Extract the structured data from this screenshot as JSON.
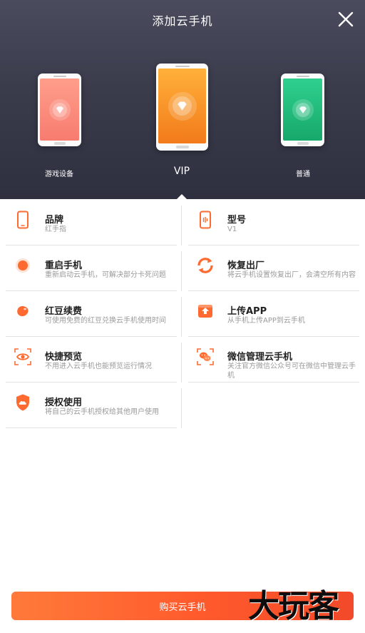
{
  "header": {
    "title": "添加云手机"
  },
  "phones": [
    {
      "label": "游戏设备",
      "color": "#f77c70"
    },
    {
      "label": "VIP",
      "color": "#f27a1a"
    },
    {
      "label": "普通",
      "color": "#17a86b"
    }
  ],
  "features": {
    "left": [
      {
        "title": "品牌",
        "desc": "红手指",
        "icon": "phone-outline-icon"
      },
      {
        "title": "重启手机",
        "desc": "重新启动云手机，可解决部分卡死问题",
        "icon": "restart-icon"
      },
      {
        "title": "红豆续费",
        "desc": "可使用免费的红豆兑换云手机使用时间",
        "icon": "bean-icon"
      },
      {
        "title": "快捷预览",
        "desc": "不用进入云手机也能预览运行情况",
        "icon": "eye-icon"
      },
      {
        "title": "授权使用",
        "desc": "将自己的云手机授权给其他用户使用",
        "icon": "shield-cloud-icon"
      }
    ],
    "right": [
      {
        "title": "型号",
        "desc": "V1",
        "icon": "phone-model-icon"
      },
      {
        "title": "恢复出厂",
        "desc": "将云手机设置恢复出厂，会清空所有内容",
        "icon": "factory-reset-icon"
      },
      {
        "title": "上传APP",
        "desc": "从手机上传APP到云手机",
        "icon": "upload-icon"
      },
      {
        "title": "微信管理云手机",
        "desc": "关注官方微信公众号可在微信中管理云手机",
        "icon": "wechat-icon"
      }
    ]
  },
  "buy_button": {
    "label": "购买云手机"
  },
  "watermark": "大玩客",
  "colors": {
    "accent": "#ff6a30",
    "header_bg": "#3a3c4c"
  }
}
